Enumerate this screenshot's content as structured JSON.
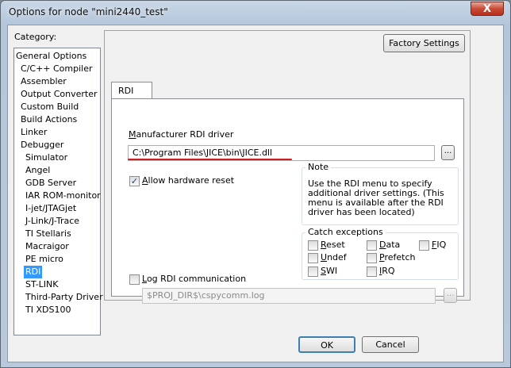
{
  "window": {
    "title": "Options for node \"mini2440_test\"",
    "close_glyph": "X"
  },
  "category": {
    "label": "Category:",
    "items": [
      {
        "label": "General Options",
        "indent": 0,
        "selected": false
      },
      {
        "label": "C/C++ Compiler",
        "indent": 1,
        "selected": false
      },
      {
        "label": "Assembler",
        "indent": 1,
        "selected": false
      },
      {
        "label": "Output Converter",
        "indent": 1,
        "selected": false
      },
      {
        "label": "Custom Build",
        "indent": 1,
        "selected": false
      },
      {
        "label": "Build Actions",
        "indent": 1,
        "selected": false
      },
      {
        "label": "Linker",
        "indent": 1,
        "selected": false
      },
      {
        "label": "Debugger",
        "indent": 1,
        "selected": false
      },
      {
        "label": "Simulator",
        "indent": 2,
        "selected": false
      },
      {
        "label": "Angel",
        "indent": 2,
        "selected": false
      },
      {
        "label": "GDB Server",
        "indent": 2,
        "selected": false
      },
      {
        "label": "IAR ROM-monitor",
        "indent": 2,
        "selected": false
      },
      {
        "label": "I-jet/JTAGjet",
        "indent": 2,
        "selected": false
      },
      {
        "label": "J-Link/J-Trace",
        "indent": 2,
        "selected": false
      },
      {
        "label": "TI Stellaris",
        "indent": 2,
        "selected": false
      },
      {
        "label": "Macraigor",
        "indent": 2,
        "selected": false
      },
      {
        "label": "PE micro",
        "indent": 2,
        "selected": false
      },
      {
        "label": "RDI",
        "indent": 2,
        "selected": true
      },
      {
        "label": "ST-LINK",
        "indent": 2,
        "selected": false
      },
      {
        "label": "Third-Party Driver",
        "indent": 2,
        "selected": false
      },
      {
        "label": "TI XDS100",
        "indent": 2,
        "selected": false
      }
    ]
  },
  "panel": {
    "factory_settings_label": "Factory Settings",
    "tab_label": "RDI",
    "driver_label_first": "M",
    "driver_label_rest": "anufacturer RDI driver",
    "driver_path": "C:\\Program Files\\JICE\\bin\\JICE.dll",
    "browse_label": "...",
    "allow_reset_label_first": "A",
    "allow_reset_label_rest": "llow hardware reset",
    "allow_reset_checked": true,
    "note_title": "Note",
    "note_lines": [
      "Use the RDI menu to specify",
      "additional driver settings. (This",
      "menu is available after the RDI",
      "driver has been located)"
    ],
    "catch_title": "Catch exceptions",
    "catch": [
      {
        "first": "R",
        "rest": "eset",
        "checked": false
      },
      {
        "first": "D",
        "rest": "ata",
        "checked": false
      },
      {
        "first": "F",
        "rest": "IQ",
        "checked": false
      },
      {
        "first": "U",
        "rest": "ndef",
        "checked": false
      },
      {
        "first": "P",
        "rest": "refetch",
        "checked": false
      },
      {
        "first": "S",
        "rest": "WI",
        "checked": false
      },
      {
        "first": "I",
        "rest": "RQ",
        "checked": false
      }
    ],
    "log_label_first": "L",
    "log_label_rest": "og RDI communication",
    "log_checked": false,
    "log_path": "$PROJ_DIR$\\cspycomm.log",
    "log_browse_label": "..."
  },
  "footer": {
    "ok_label": "OK",
    "cancel_label": "Cancel"
  },
  "colors": {
    "selection": "#3399ff",
    "annotation_underline": "#d01e1e"
  }
}
